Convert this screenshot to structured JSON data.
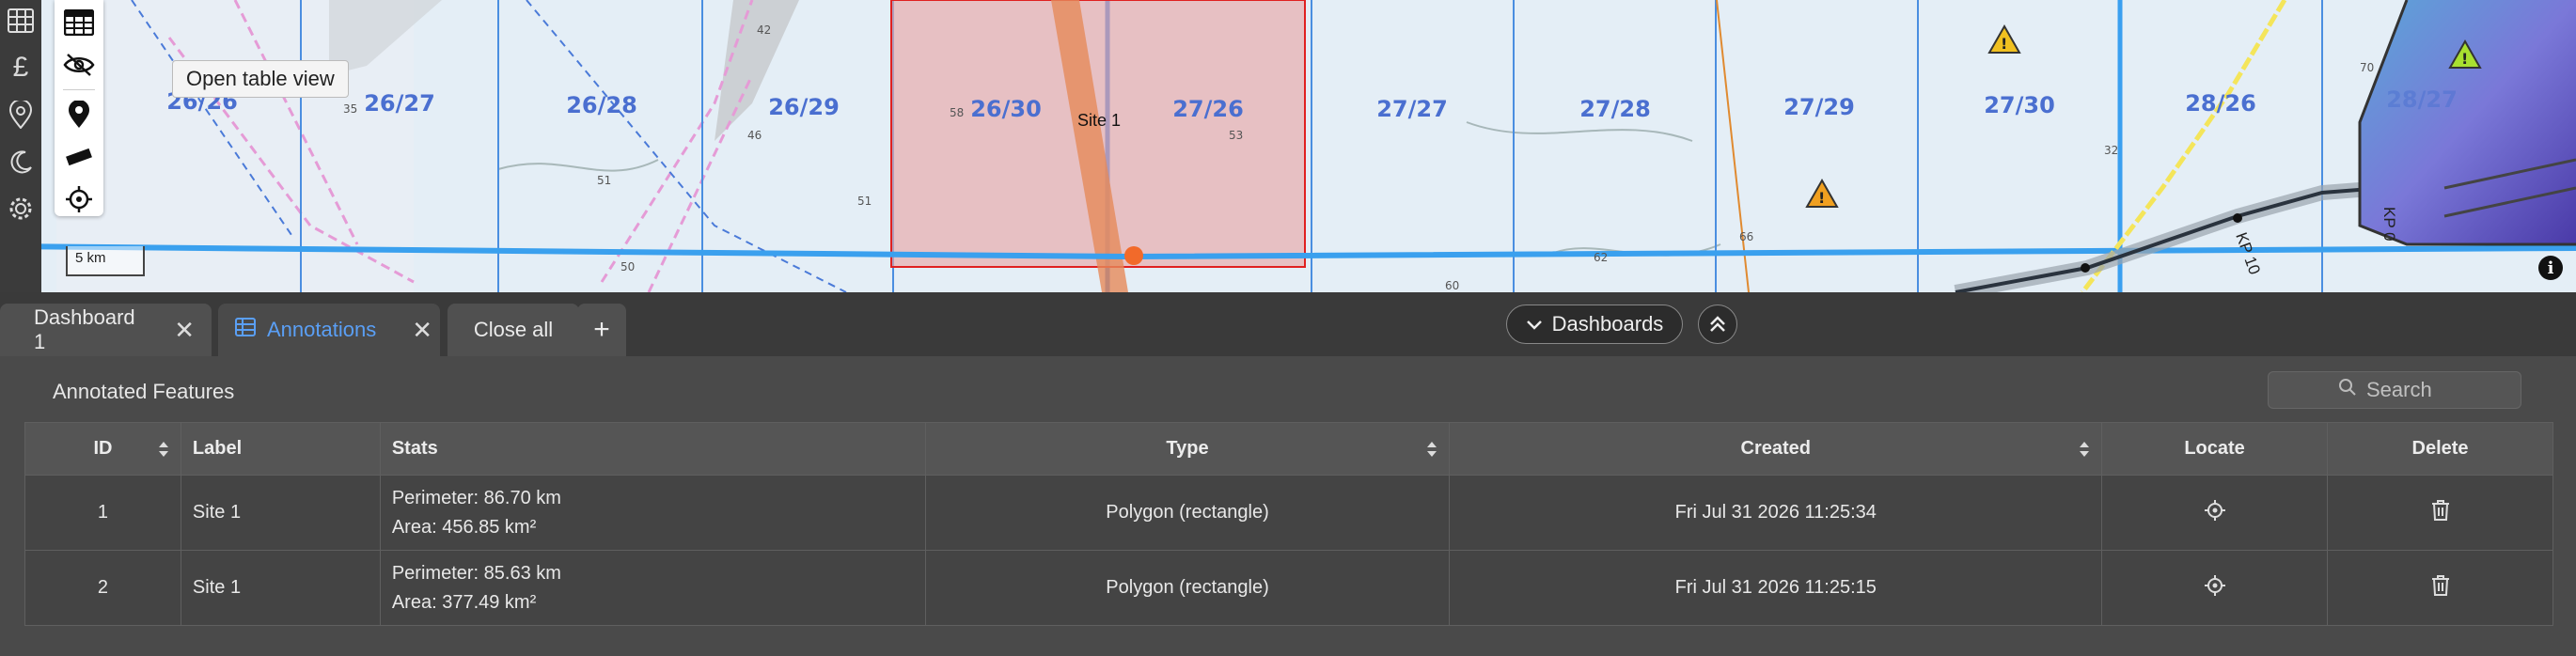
{
  "map": {
    "tooltip": "Open table view",
    "scale_label": "5 km",
    "info_label": "i",
    "site_label": "Site 1",
    "blocks": [
      "26/26",
      "26/27",
      "26/28",
      "26/29",
      "26/30",
      "27/26",
      "27/27",
      "27/28",
      "27/29",
      "27/30",
      "28/26",
      "28/27"
    ],
    "kp_labels": [
      "KP 10",
      "KP 0"
    ],
    "colors": {
      "water": "#e4eef6",
      "grid": "#4a8ee0",
      "pipeline": "#3aa0ee",
      "site_fill": "#e8a8a8",
      "site_stroke": "#e02020"
    }
  },
  "rail": {
    "icons": [
      "table-grid-icon",
      "pound-sign-icon",
      "map-pin-icon",
      "moon-icon",
      "gear-icon"
    ],
    "pound": "£"
  },
  "tools": [
    "table-view-icon",
    "hide-icon",
    "place-marker-icon",
    "ruler-icon",
    "locate-crosshair-icon"
  ],
  "tabs": {
    "dashboard1": "Dashboard 1",
    "annotations": "Annotations",
    "close_all": "Close all",
    "add": "+",
    "close_glyph": "✕"
  },
  "dashboards_button": "Dashboards",
  "panel": {
    "title": "Annotated Features",
    "search_placeholder": "Search",
    "columns": {
      "id": "ID",
      "label": "Label",
      "stats": "Stats",
      "type": "Type",
      "created": "Created",
      "locate": "Locate",
      "delete": "Delete"
    },
    "rows": [
      {
        "id": "1",
        "label": "Site 1",
        "perimeter": "Perimeter: 86.70 km",
        "area": "Area: 456.85 km²",
        "type": "Polygon (rectangle)",
        "created": "Fri Jul 31 2026 11:25:34"
      },
      {
        "id": "2",
        "label": "Site 1",
        "perimeter": "Perimeter: 85.63 km",
        "area": "Area: 377.49 km²",
        "type": "Polygon (rectangle)",
        "created": "Fri Jul 31 2026 11:25:15"
      }
    ]
  }
}
